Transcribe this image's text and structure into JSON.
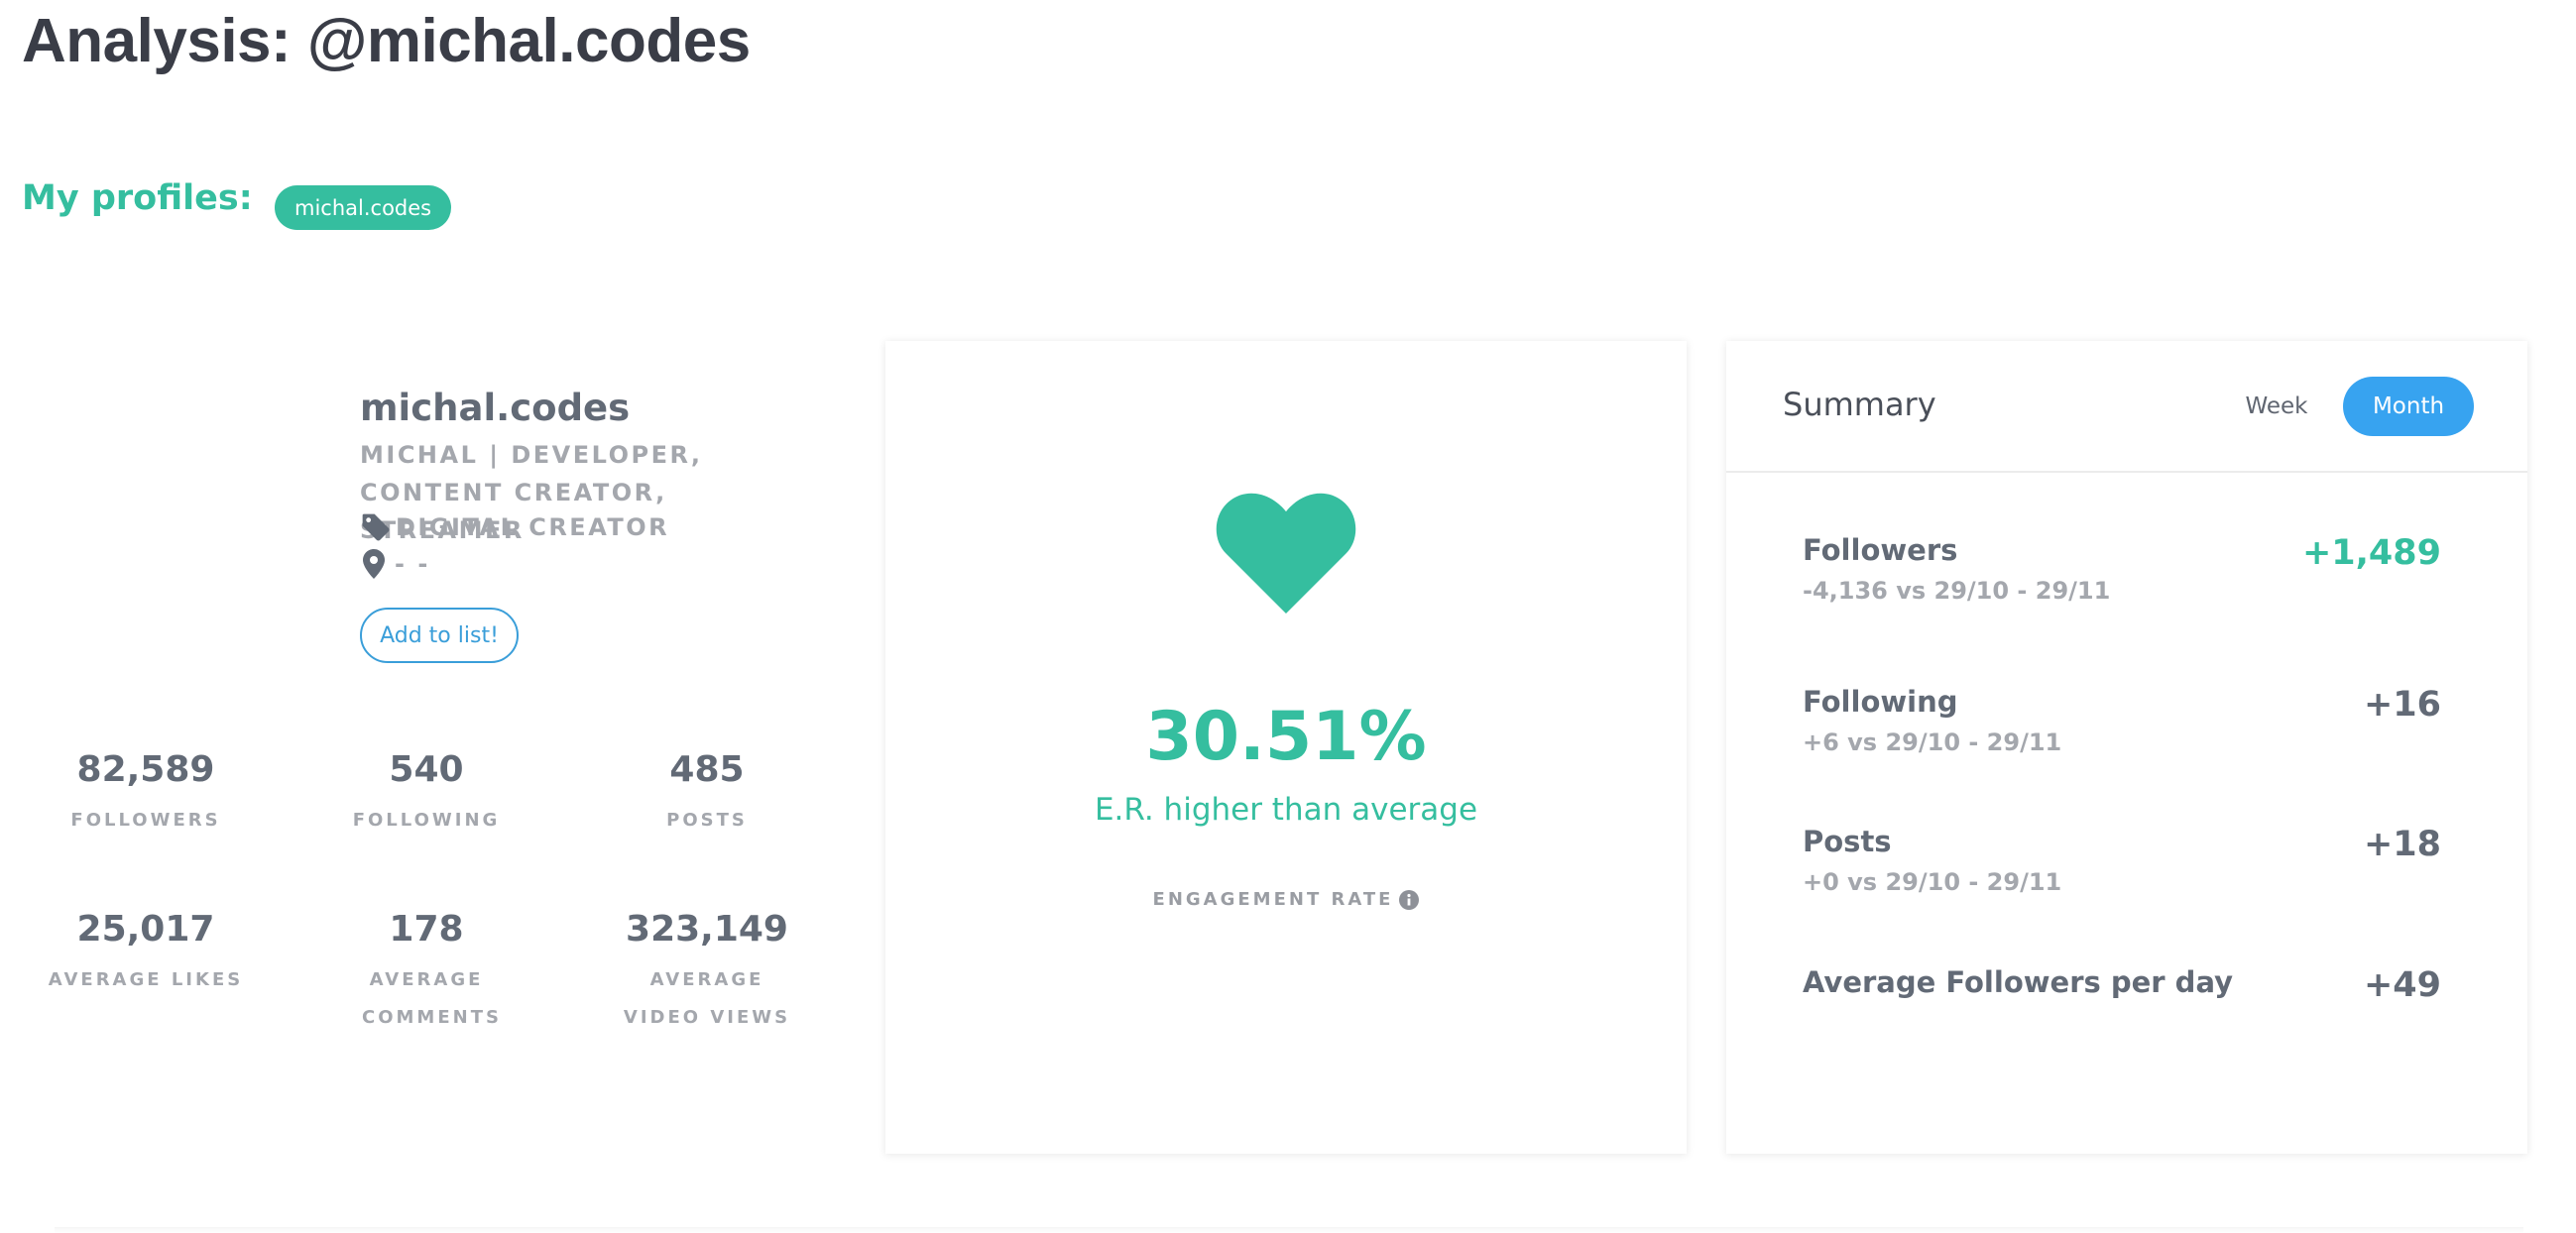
{
  "page": {
    "title": "Analysis: @michal.codes"
  },
  "profiles": {
    "label": "My profiles:",
    "items": [
      "michal.codes"
    ]
  },
  "profile": {
    "username": "michal.codes",
    "bio": "MICHAL | DEVELOPER, CONTENT CREATOR, STREAMER",
    "category": "DIGITAL CREATOR",
    "location": "- -",
    "add_button": "Add to list!",
    "icons": {
      "category": "tag-icon",
      "location": "location-pin-icon"
    }
  },
  "stats": [
    {
      "value": "82,589",
      "label": "FOLLOWERS"
    },
    {
      "value": "540",
      "label": "FOLLOWING"
    },
    {
      "value": "485",
      "label": "POSTS"
    },
    {
      "value": "25,017",
      "label": "AVERAGE LIKES"
    },
    {
      "value": "178",
      "label": "AVERAGE COMMENTS"
    },
    {
      "value": "323,149",
      "label": "AVERAGE VIDEO VIEWS"
    }
  ],
  "engagement": {
    "value": "30.51%",
    "caption": "E.R. higher than average",
    "label": "ENGAGEMENT RATE",
    "icon": "heart-icon"
  },
  "summary": {
    "title": "Summary",
    "tabs": {
      "week": "Week",
      "month": "Month",
      "active": "Month"
    },
    "rows": [
      {
        "label": "Followers",
        "sub": "-4,136 vs 29/10 - 29/11",
        "value": "+1,489"
      },
      {
        "label": "Following",
        "sub": "+6 vs 29/10 - 29/11",
        "value": "+16"
      },
      {
        "label": "Posts",
        "sub": "+0 vs 29/10 - 29/11",
        "value": "+18"
      },
      {
        "label": "Average Followers per day",
        "sub": "",
        "value": "+49"
      }
    ]
  },
  "colors": {
    "accent_green": "#35be9f",
    "accent_blue": "#37a3f0",
    "text_dark": "#3a3d47",
    "text_muted": "#a4a7ad"
  }
}
